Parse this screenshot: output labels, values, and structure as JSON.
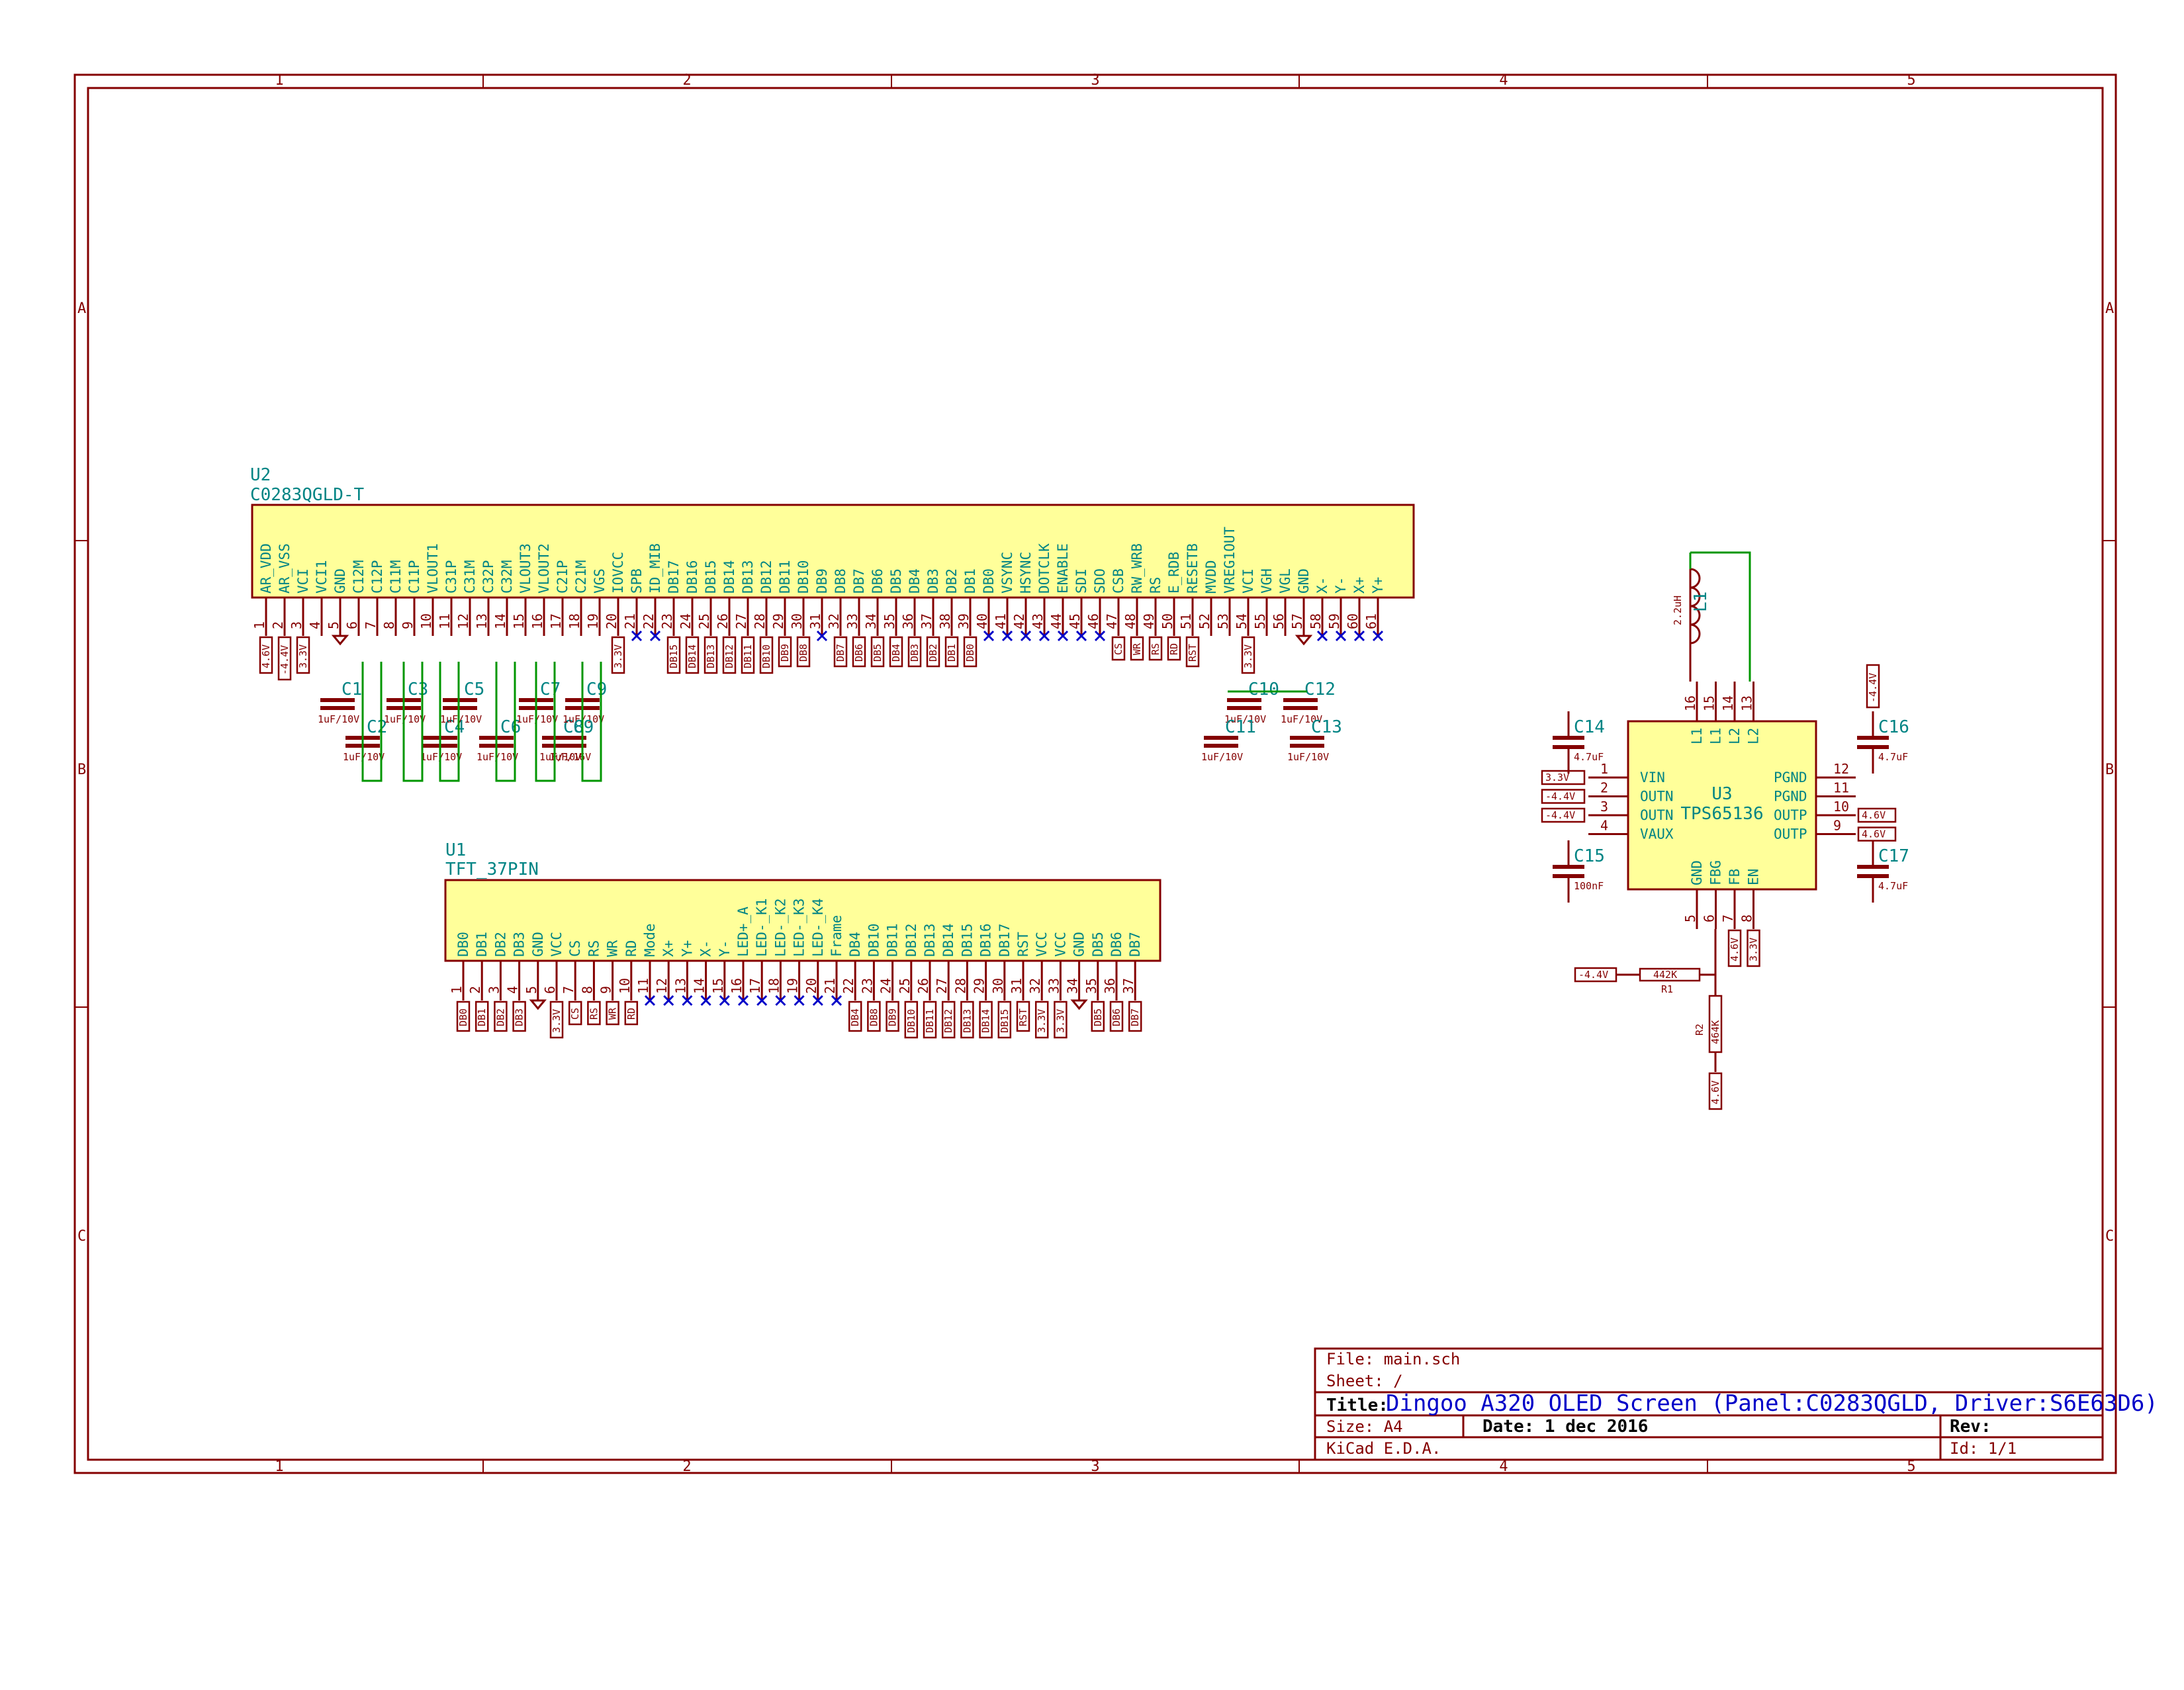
{
  "sheet": {
    "zones_top": [
      "1",
      "2",
      "3",
      "4",
      "5"
    ],
    "zones_side": [
      "A",
      "B",
      "C"
    ]
  },
  "u2": {
    "ref": "U2",
    "value": "C0283QGLD-T",
    "pins": [
      [
        "1",
        "AR_VDD",
        "4.6V"
      ],
      [
        "2",
        "AR_VSS",
        "-4.4V"
      ],
      [
        "3",
        "VCI",
        "3.3V"
      ],
      [
        "4",
        "VCI1",
        ""
      ],
      [
        "5",
        "GND",
        ""
      ],
      [
        "6",
        "C12M",
        ""
      ],
      [
        "7",
        "C12P",
        ""
      ],
      [
        "8",
        "C11M",
        ""
      ],
      [
        "9",
        "C11P",
        ""
      ],
      [
        "10",
        "VLOUT1",
        ""
      ],
      [
        "11",
        "C31P",
        ""
      ],
      [
        "12",
        "C31M",
        ""
      ],
      [
        "13",
        "C32P",
        ""
      ],
      [
        "14",
        "C32M",
        ""
      ],
      [
        "15",
        "VLOUT3",
        ""
      ],
      [
        "16",
        "VLOUT2",
        ""
      ],
      [
        "17",
        "C21P",
        ""
      ],
      [
        "18",
        "C21M",
        ""
      ],
      [
        "19",
        "VGS",
        ""
      ],
      [
        "20",
        "IOVCC",
        "3.3V"
      ],
      [
        "21",
        "SPB",
        ""
      ],
      [
        "22",
        "ID_MIB",
        ""
      ],
      [
        "23",
        "DB17",
        "DB15"
      ],
      [
        "24",
        "DB16",
        "DB14"
      ],
      [
        "25",
        "DB15",
        "DB13"
      ],
      [
        "26",
        "DB14",
        "DB12"
      ],
      [
        "27",
        "DB13",
        "DB11"
      ],
      [
        "28",
        "DB12",
        "DB10"
      ],
      [
        "29",
        "DB11",
        "DB9"
      ],
      [
        "30",
        "DB10",
        "DB8"
      ],
      [
        "31",
        "DB9",
        ""
      ],
      [
        "32",
        "DB8",
        "DB7"
      ],
      [
        "33",
        "DB7",
        "DB6"
      ],
      [
        "34",
        "DB6",
        "DB5"
      ],
      [
        "35",
        "DB5",
        "DB4"
      ],
      [
        "36",
        "DB4",
        "DB3"
      ],
      [
        "37",
        "DB3",
        "DB2"
      ],
      [
        "38",
        "DB2",
        "DB1"
      ],
      [
        "39",
        "DB1",
        "DB0"
      ],
      [
        "40",
        "DB0",
        ""
      ],
      [
        "41",
        "VSYNC",
        ""
      ],
      [
        "42",
        "HSYNC",
        ""
      ],
      [
        "43",
        "DOTCLK",
        ""
      ],
      [
        "44",
        "ENABLE",
        ""
      ],
      [
        "45",
        "SDI",
        ""
      ],
      [
        "46",
        "SDO",
        ""
      ],
      [
        "47",
        "CSB",
        "CS"
      ],
      [
        "48",
        "RW_WRB",
        "WR"
      ],
      [
        "49",
        "RS",
        "RS"
      ],
      [
        "50",
        "E_RDB",
        "RD"
      ],
      [
        "51",
        "RESETB",
        "RST"
      ],
      [
        "52",
        "MVDD",
        ""
      ],
      [
        "53",
        "VREG1OUT",
        ""
      ],
      [
        "54",
        "VCI",
        "3.3V"
      ],
      [
        "55",
        "VGH",
        ""
      ],
      [
        "56",
        "VGL",
        ""
      ],
      [
        "57",
        "GND",
        ""
      ],
      [
        "58",
        "X-",
        ""
      ],
      [
        "59",
        "Y-",
        ""
      ],
      [
        "60",
        "X+",
        ""
      ],
      [
        "61",
        "Y+",
        ""
      ]
    ],
    "caps": [
      {
        "ref": "C1",
        "value": "1uF/10V"
      },
      {
        "ref": "C2",
        "value": "1uF/10V"
      },
      {
        "ref": "C3",
        "value": "1uF/10V"
      },
      {
        "ref": "C4",
        "value": "1uF/10V"
      },
      {
        "ref": "C5",
        "value": "1uF/10V"
      },
      {
        "ref": "C6",
        "value": "1uF/10V"
      },
      {
        "ref": "C7",
        "value": "1uF/10V"
      },
      {
        "ref": "C8",
        "value": "1uF/10V"
      },
      {
        "ref": "C9",
        "value": "1uF/10V"
      },
      {
        "ref": "C9b",
        "value": "1uF/16V"
      },
      {
        "ref": "C10",
        "value": "1uF/10V"
      },
      {
        "ref": "C11",
        "value": "1uF/10V"
      },
      {
        "ref": "C12",
        "value": "1uF/10V"
      },
      {
        "ref": "C13",
        "value": "1uF/10V"
      }
    ]
  },
  "u1": {
    "ref": "U1",
    "value": "TFT_37PIN",
    "pins": [
      [
        "1",
        "DB0",
        "DB0"
      ],
      [
        "2",
        "DB1",
        "DB1"
      ],
      [
        "3",
        "DB2",
        "DB2"
      ],
      [
        "4",
        "DB3",
        "DB3"
      ],
      [
        "5",
        "GND",
        ""
      ],
      [
        "6",
        "VCC",
        "3.3V"
      ],
      [
        "7",
        "CS",
        "CS"
      ],
      [
        "8",
        "RS",
        "RS"
      ],
      [
        "9",
        "WR",
        "WR"
      ],
      [
        "10",
        "RD",
        "RD"
      ],
      [
        "11",
        "Mode",
        ""
      ],
      [
        "12",
        "X+",
        ""
      ],
      [
        "13",
        "Y+",
        ""
      ],
      [
        "14",
        "X-",
        ""
      ],
      [
        "15",
        "Y-",
        ""
      ],
      [
        "16",
        "LED+_A",
        ""
      ],
      [
        "17",
        "LED-_K1",
        ""
      ],
      [
        "18",
        "LED-_K2",
        ""
      ],
      [
        "19",
        "LED-_K3",
        ""
      ],
      [
        "20",
        "LED-_K4",
        ""
      ],
      [
        "21",
        "Frame",
        ""
      ],
      [
        "22",
        "DB4",
        "DB4"
      ],
      [
        "23",
        "DB10",
        "DB8"
      ],
      [
        "24",
        "DB11",
        "DB9"
      ],
      [
        "25",
        "DB12",
        "DB10"
      ],
      [
        "26",
        "DB13",
        "DB11"
      ],
      [
        "27",
        "DB14",
        "DB12"
      ],
      [
        "28",
        "DB15",
        "DB13"
      ],
      [
        "29",
        "DB16",
        "DB14"
      ],
      [
        "30",
        "DB17",
        "DB15"
      ],
      [
        "31",
        "RST",
        "RST"
      ],
      [
        "32",
        "VCC",
        "3.3V"
      ],
      [
        "33",
        "VCC",
        "3.3V"
      ],
      [
        "34",
        "GND",
        ""
      ],
      [
        "35",
        "DB5",
        "DB5"
      ],
      [
        "36",
        "DB6",
        "DB6"
      ],
      [
        "37",
        "DB7",
        "DB7"
      ]
    ]
  },
  "u3": {
    "ref": "U3",
    "value": "TPS65136",
    "left_pins": [
      [
        "1",
        "VIN",
        "3.3V"
      ],
      [
        "2",
        "OUTN",
        "-4.4V"
      ],
      [
        "3",
        "OUTN",
        "-4.4V"
      ],
      [
        "4",
        "VAUX",
        ""
      ]
    ],
    "right_pins": [
      [
        "12",
        "PGND",
        ""
      ],
      [
        "11",
        "PGND",
        ""
      ],
      [
        "10",
        "OUTP",
        "4.6V"
      ],
      [
        "9",
        "OUTP",
        "4.6V"
      ]
    ],
    "top_pins": [
      [
        "16",
        "L1"
      ],
      [
        "15",
        "L1"
      ],
      [
        "14",
        "L2"
      ],
      [
        "13",
        "L2"
      ]
    ],
    "bottom_pins": [
      [
        "5",
        "GND",
        ""
      ],
      [
        "6",
        "FBG",
        ""
      ],
      [
        "7",
        "FB",
        "4.6V"
      ],
      [
        "8",
        "EN",
        "3.3V"
      ]
    ],
    "inductor": {
      "ref": "L1",
      "value": "2.2uH"
    },
    "r1": {
      "ref": "R1",
      "value": "442K",
      "net": "-4.4V"
    },
    "r2": {
      "ref": "R2",
      "value": "464K",
      "net": "4.6V"
    },
    "c14": {
      "ref": "C14",
      "value": "4.7uF"
    },
    "c15": {
      "ref": "C15",
      "value": "100nF"
    },
    "c16": {
      "ref": "C16",
      "value": "4.7uF",
      "net": "-4.4V"
    },
    "c17": {
      "ref": "C17",
      "value": "4.7uF"
    }
  },
  "title_block": {
    "file": "File: main.sch",
    "sheet": "Sheet: /",
    "title_label": "Title:",
    "title": "Dingoo A320 OLED Screen (Panel:C0283QGLD, Driver:S6E63D6)",
    "size": "Size: A4",
    "date": "Date: 1 dec 2016",
    "rev": "Rev:",
    "tool": "KiCad E.D.A.",
    "id": "Id: 1/1"
  }
}
